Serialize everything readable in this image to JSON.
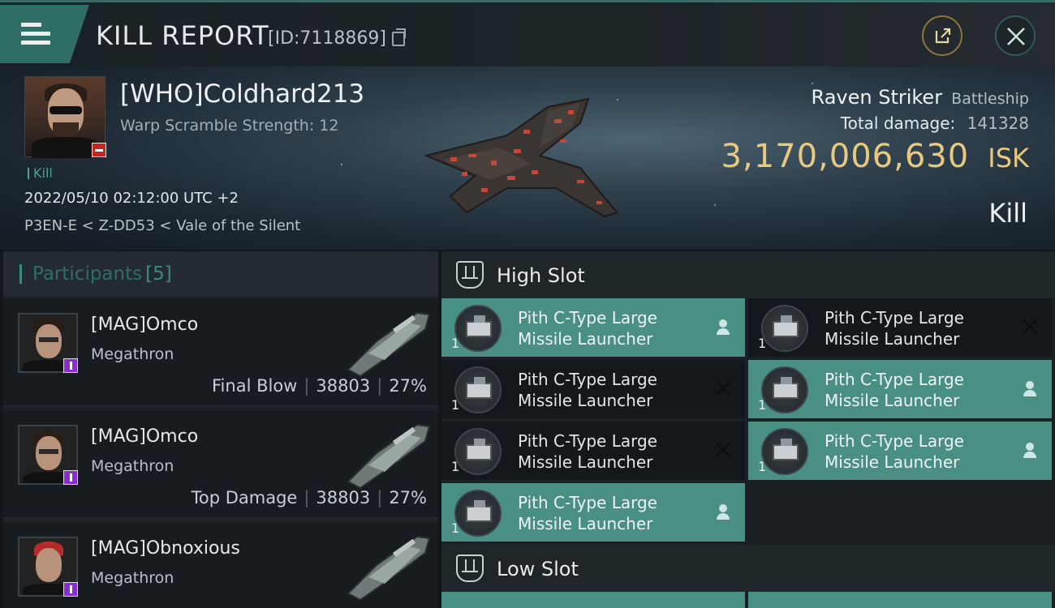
{
  "header": {
    "title": "KILL REPORT",
    "report_id": "[ID:7118869]"
  },
  "victim": {
    "name": "[WHO]Coldhard213",
    "scramble": "Warp Scramble Strength: 12",
    "tag": "Kill",
    "timestamp": "2022/05/10 02:12:00 UTC +2",
    "location": "P3EN-E < Z-DD53 < Vale of the Silent",
    "ship_name": "Raven Striker",
    "ship_class": "Battleship",
    "damage_label": "Total damage:",
    "damage_value": "141328",
    "isk_value": "3,170,006,630",
    "isk_unit": "ISK",
    "result": "Kill"
  },
  "participants": {
    "title": "Participants",
    "count": "[5]",
    "items": [
      {
        "name": "[MAG]Omco",
        "ship": "Megathron",
        "stat_label": "Final Blow",
        "damage": "38803",
        "percent": "27%"
      },
      {
        "name": "[MAG]Omco",
        "ship": "Megathron",
        "stat_label": "Top Damage",
        "damage": "38803",
        "percent": "27%"
      },
      {
        "name": "[MAG]Obnoxious",
        "ship": "Megathron",
        "stat_label": "",
        "damage": "",
        "percent": ""
      }
    ]
  },
  "fitting": {
    "high_slot_label": "High Slot",
    "low_slot_label": "Low Slot",
    "high_slots": [
      {
        "line1": "Pith C-Type Large",
        "line2": "Missile Launcher",
        "qty": "1",
        "state": "dropped"
      },
      {
        "line1": "Pith C-Type Large",
        "line2": "Missile Launcher",
        "qty": "1",
        "state": "destroyed"
      },
      {
        "line1": "Pith C-Type Large",
        "line2": "Missile Launcher",
        "qty": "1",
        "state": "destroyed"
      },
      {
        "line1": "Pith C-Type Large",
        "line2": "Missile Launcher",
        "qty": "1",
        "state": "dropped"
      },
      {
        "line1": "Pith C-Type Large",
        "line2": "Missile Launcher",
        "qty": "1",
        "state": "destroyed"
      },
      {
        "line1": "Pith C-Type Large",
        "line2": "Missile Launcher",
        "qty": "1",
        "state": "dropped"
      },
      {
        "line1": "Pith C-Type Large",
        "line2": "Missile Launcher",
        "qty": "1",
        "state": "dropped"
      }
    ]
  },
  "colors": {
    "accent": "#2f6e66",
    "isk": "#e9c980",
    "dropped": "#4a8f84",
    "danger": "#c92323"
  }
}
